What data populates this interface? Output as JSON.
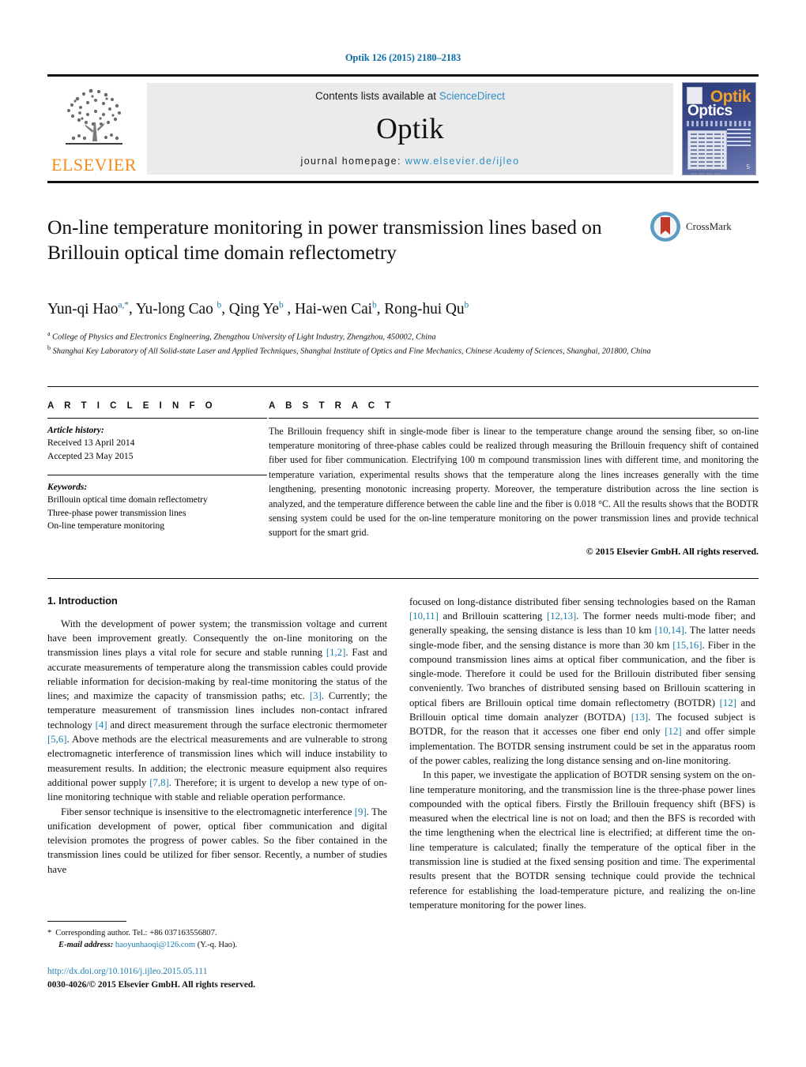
{
  "running_head": "Optik 126 (2015) 2180–2183",
  "masthead": {
    "publisher_name": "ELSEVIER",
    "contents_prefix": "Contents lists available at ",
    "contents_link": "ScienceDirect",
    "journal_name": "Optik",
    "homepage_prefix": "journal homepage: ",
    "homepage_url": "www.elsevier.de/ijleo",
    "cover": {
      "title_top": "Optik",
      "title_bottom": "Optics",
      "issue_mark": "5"
    }
  },
  "article": {
    "title": "On-line temperature monitoring in power transmission lines based on Brillouin optical time domain reflectometry",
    "crossmark_label": "CrossMark",
    "authors": [
      {
        "name": "Yun-qi Hao",
        "marks": "a,*"
      },
      {
        "name": "Yu-long Cao",
        "marks": "b"
      },
      {
        "name": "Qing Ye",
        "marks": "b"
      },
      {
        "name": "Hai-wen Cai",
        "marks": "b"
      },
      {
        "name": "Rong-hui Qu",
        "marks": "b"
      }
    ],
    "affiliations": [
      {
        "mark": "a",
        "text": "College of Physics and Electronics Engineering, Zhengzhou University of Light Industry, Zhengzhou, 450002, China"
      },
      {
        "mark": "b",
        "text": "Shanghai Key Laboratory of All Solid-state Laser and Applied Techniques, Shanghai Institute of Optics and Fine Mechanics, Chinese Academy of Sciences, Shanghai, 201800, China"
      }
    ]
  },
  "article_info": {
    "heading": "A R T I C L E   I N F O",
    "history_label": "Article history:",
    "history": [
      "Received 13 April 2014",
      "Accepted 23 May 2015"
    ],
    "keywords_label": "Keywords:",
    "keywords": [
      "Brillouin optical time domain reflectometry",
      "Three-phase power transmission lines",
      "On-line temperature monitoring"
    ]
  },
  "abstract": {
    "heading": "A B S T R A C T",
    "text": "The Brillouin frequency shift in single-mode fiber is linear to the temperature change around the sensing fiber, so on-line temperature monitoring of three-phase cables could be realized through measuring the Brillouin frequency shift of contained fiber used for fiber communication. Electrifying 100 m compound transmission lines with different time, and monitoring the temperature variation, experimental results shows that the temperature along the lines increases generally with the time lengthening, presenting monotonic increasing property. Moreover, the temperature distribution across the line section is analyzed, and the temperature difference between the cable line and the fiber is 0.018 °C. All the results shows that the BODTR sensing system could be used for the on-line temperature monitoring on the power transmission lines and provide technical support for the smart grid.",
    "copyright": "© 2015 Elsevier GmbH. All rights reserved."
  },
  "body": {
    "section_heading": "1.  Introduction",
    "left_paragraphs": [
      "With the development of power system; the transmission voltage and current have been improvement greatly. Consequently the on-line monitoring on the transmission lines plays a vital role for secure and stable running [1,2]. Fast and accurate measurements of temperature along the transmission cables could provide reliable information for decision-making by real-time monitoring the status of the lines; and maximize the capacity of transmission paths; etc. [3]. Currently; the temperature measurement of transmission lines includes non-contact infrared technology [4] and direct measurement through the surface electronic thermometer [5,6]. Above methods are the electrical measurements and are vulnerable to strong electromagnetic interference of transmission lines which will induce instability to measurement results. In addition; the electronic measure equipment also requires additional power supply [7,8]. Therefore; it is urgent to develop a new type of on-line monitoring technique with stable and reliable operation performance.",
      "Fiber sensor technique is insensitive to the electromagnetic interference [9]. The unification development of power, optical fiber communication and digital television promotes the progress of power cables. So the fiber contained in the transmission lines could be utilized for fiber sensor. Recently, a number of studies have"
    ],
    "right_paragraphs": [
      "focused on long-distance distributed fiber sensing technologies based on the Raman [10,11] and Brillouin scattering [12,13]. The former needs multi-mode fiber; and generally speaking, the sensing distance is less than 10 km [10,14]. The latter needs single-mode fiber, and the sensing distance is more than 30 km [15,16]. Fiber in the compound transmission lines aims at optical fiber communication, and the fiber is single-mode. Therefore it could be used for the Brillouin distributed fiber sensing conveniently. Two branches of distributed sensing based on Brillouin scattering in optical fibers are Brillouin optical time domain reflectometry (BOTDR) [12] and Brillouin optical time domain analyzer (BOTDA) [13]. The focused subject is BOTDR, for the reason that it accesses one fiber end only [12] and offer simple implementation. The BOTDR sensing instrument could be set in the apparatus room of the power cables, realizing the long distance sensing and on-line monitoring.",
      "In this paper, we investigate the application of BOTDR sensing system on the on-line temperature monitoring, and the transmission line is the three-phase power lines compounded with the optical fibers. Firstly the Brillouin frequency shift (BFS) is measured when the electrical line is not on load; and then the BFS is recorded with the time lengthening when the electrical line is electrified; at different time the on-line temperature is calculated; finally the temperature of the optical fiber in the transmission line is studied at the fixed sensing position and time. The experimental results present that the BOTDR sensing technique could provide the technical reference for establishing the load-temperature picture, and realizing the on-line temperature monitoring for the power lines."
    ]
  },
  "footnotes": {
    "corresponding_star": "*",
    "corresponding_text": "Corresponding author. Tel.: +86 037163556807.",
    "email_label": "E-mail address:",
    "email": "haoyunhaoqi@126.com",
    "email_suffix": "(Y.-q. Hao)."
  },
  "bottom": {
    "doi": "http://dx.doi.org/10.1016/j.ijleo.2015.05.111",
    "issn_line": "0030-4026/© 2015 Elsevier GmbH. All rights reserved."
  },
  "colors": {
    "link": "#1a7db0",
    "elsevier_orange": "#f08c1b",
    "sciencedirect": "#2e8fc6"
  }
}
